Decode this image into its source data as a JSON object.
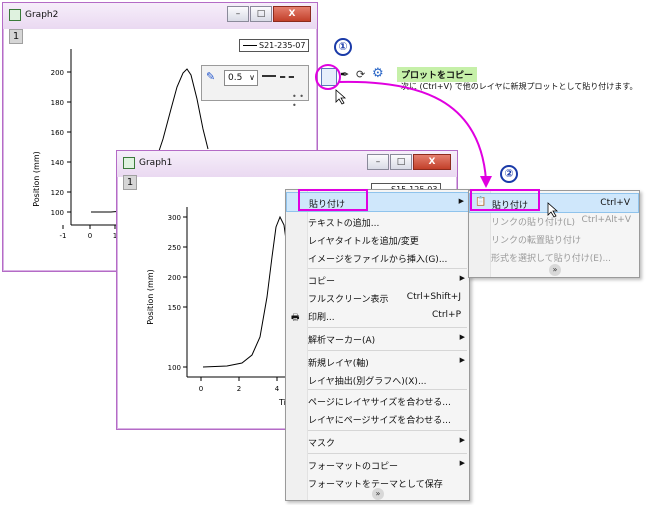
{
  "graph2": {
    "title": "Graph2",
    "layer": "1",
    "legend": "S21-235-07",
    "ylabel": "Position (mm)",
    "yticks": [
      "200",
      "180",
      "160",
      "140",
      "120",
      "100"
    ],
    "xticks": [
      "-1",
      "0",
      "1"
    ]
  },
  "toolbar": {
    "line_width": "0.5",
    "dropdown_glyph": "∨"
  },
  "tooltip": {
    "title": "プロットをコピー",
    "desc": "次に (Ctrl+V) で他のレイヤに新規プロットとして貼り付けます。"
  },
  "graph1": {
    "title": "Graph1",
    "layer": "1",
    "legend": "S15-125-03",
    "ylabel": "Position (mm)",
    "yticks": [
      "300",
      "250",
      "200",
      "150",
      "100"
    ],
    "xticks": [
      "0",
      "2",
      "4"
    ],
    "xlabel": "Tim"
  },
  "steps": {
    "one": "①",
    "two": "②"
  },
  "context_menu": {
    "items": [
      {
        "label": "貼り付け",
        "submenu": true
      },
      {
        "label": "テキストの追加..."
      },
      {
        "label": "レイヤタイトルを追加/変更"
      },
      {
        "label": "イメージをファイルから挿入(G)..."
      },
      {
        "label": "コピー",
        "submenu": true
      },
      {
        "label": "フルスクリーン表示",
        "shortcut": "Ctrl+Shift+J"
      },
      {
        "label": "印刷...",
        "shortcut": "Ctrl+P"
      },
      {
        "label": "解析マーカー(A)",
        "submenu": true
      },
      {
        "label": "新規レイヤ(軸)",
        "submenu": true
      },
      {
        "label": "レイヤ抽出(別グラフへ)(X)..."
      },
      {
        "label": "ページにレイヤサイズを合わせる..."
      },
      {
        "label": "レイヤにページサイズを合わせる..."
      },
      {
        "label": "マスク",
        "submenu": true
      },
      {
        "label": "フォーマットのコピー",
        "submenu": true
      },
      {
        "label": "フォーマットをテーマとして保存"
      }
    ]
  },
  "submenu": {
    "items": [
      {
        "label": "貼り付け",
        "shortcut": "Ctrl+V",
        "enabled": true
      },
      {
        "label": "リンクの貼り付け(L)",
        "shortcut": "Ctrl+Alt+V",
        "enabled": false
      },
      {
        "label": "リンクの転置貼り付け",
        "enabled": false
      },
      {
        "label": "形式を選択して貼り付け(E)...",
        "enabled": false
      }
    ]
  },
  "colors": {
    "accent": "#e000e0",
    "step": "#1a3aa8",
    "tooltip_bg": "#c6f0a9",
    "menu_highlight": "#cfe7fb"
  },
  "more_glyph": "»",
  "window_buttons": {
    "minimize": "–",
    "maximize": "□",
    "close": "X"
  },
  "gear": "⚙"
}
